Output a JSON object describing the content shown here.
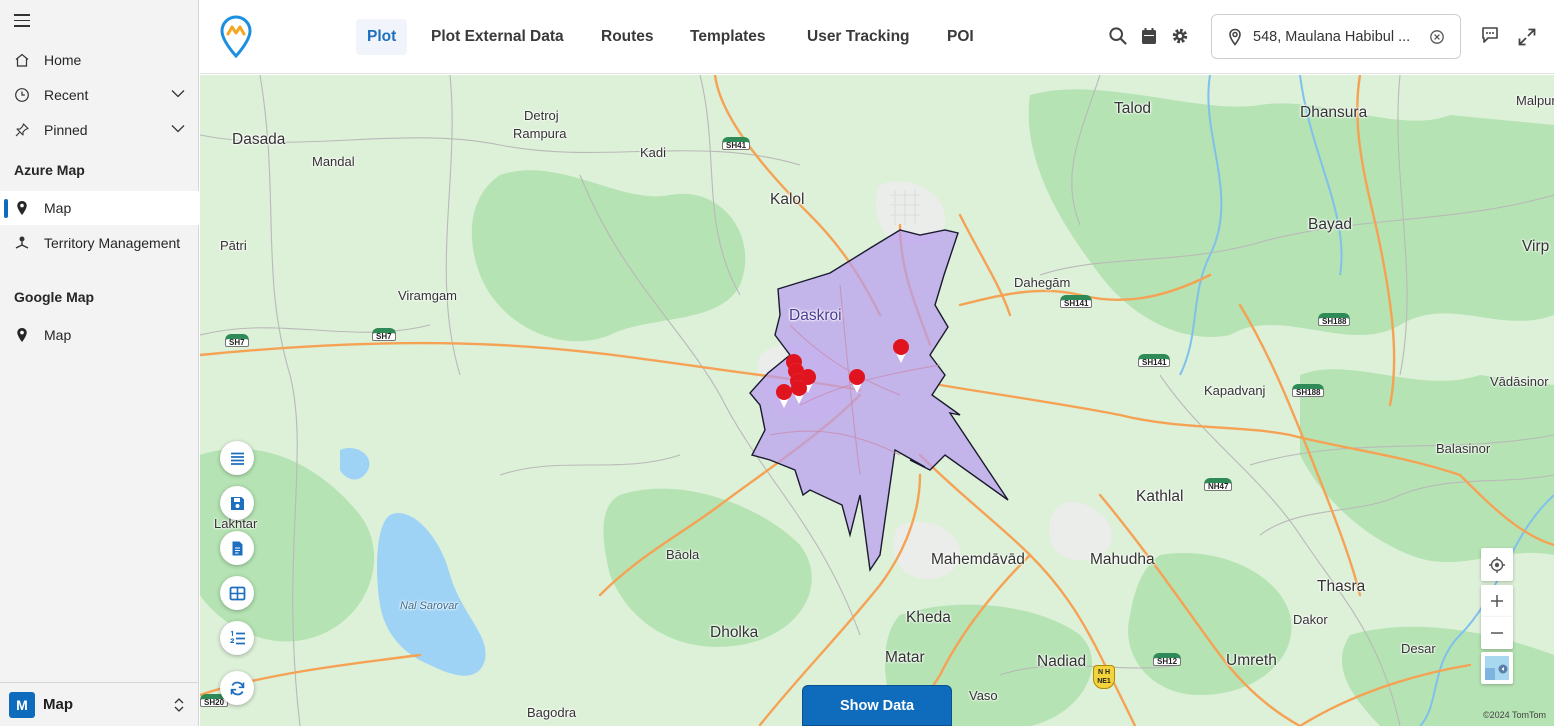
{
  "sidebar": {
    "items": [
      {
        "label": "Home"
      },
      {
        "label": "Recent"
      },
      {
        "label": "Pinned"
      }
    ],
    "sections": [
      {
        "title": "Azure Map",
        "items": [
          {
            "label": "Map"
          },
          {
            "label": "Territory Management"
          }
        ]
      },
      {
        "title": "Google Map",
        "items": [
          {
            "label": "Map"
          }
        ]
      }
    ],
    "app_switcher": {
      "badge": "M",
      "label": "Map"
    }
  },
  "header": {
    "tabs": [
      {
        "label": "Plot",
        "active": true
      },
      {
        "label": "Plot External Data"
      },
      {
        "label": "Routes"
      },
      {
        "label": "Templates"
      },
      {
        "label": "User Tracking"
      },
      {
        "label": "POI"
      }
    ],
    "search": {
      "value": "548, Maulana Habibul ..."
    }
  },
  "map": {
    "places": [
      "Dasada",
      "Mandal",
      "Detroj",
      "Rampura",
      "Kadi",
      "Kalol",
      "Talod",
      "Dhansura",
      "Malpur",
      "Pātri",
      "Viramgam",
      "Dahegām",
      "Bayad",
      "Virp",
      "Daskroi",
      "Kapadvanj",
      "Vādāsinor",
      "Balasinor",
      "Kathlal",
      "Lakhtar",
      "Bāola",
      "Mahemdāvād",
      "Mahudha",
      "Thasra",
      "Nal Sarovar",
      "Dholka",
      "Kheda",
      "Dakor",
      "Matar",
      "Nadiad",
      "Umreth",
      "Desar",
      "Vaso",
      "Bagodra"
    ],
    "highways": [
      "SH41",
      "SH7",
      "SH7",
      "SH141",
      "SH188",
      "SH141",
      "SH188",
      "NH47",
      "SH12",
      "SH20"
    ],
    "national_highway": {
      "line1": "N H",
      "line2": "NE1"
    },
    "markers_count": 8,
    "show_data_label": "Show Data",
    "copyright": "©2024 TomTom",
    "colors": {
      "territory_fill": "#b89cf0",
      "territory_stroke": "#1a1a2e",
      "marker": "#e0141e",
      "accent": "#0f6cbd"
    }
  }
}
